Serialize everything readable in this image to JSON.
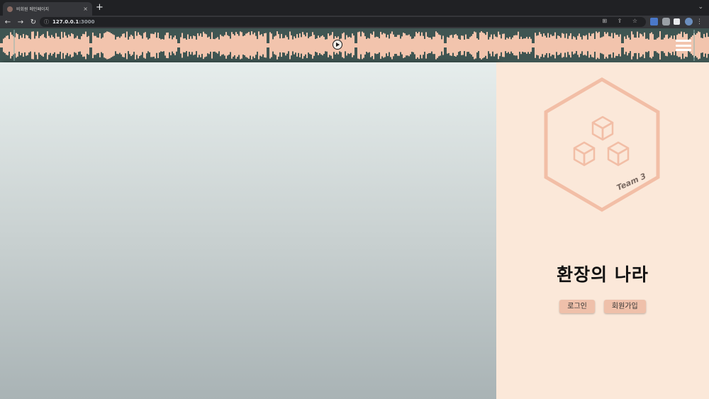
{
  "browser": {
    "tab_title": "비회원 메인페이지",
    "tab_close": "×",
    "new_tab": "+",
    "tab_menu": "⌄",
    "nav": {
      "back": "←",
      "forward": "→",
      "reload": "↻"
    },
    "url_host": "127.0.0.1",
    "url_port": ":3000",
    "info_icon": "ⓘ",
    "tools": "⊞ ⇪ ☆",
    "menu": "⋮"
  },
  "page": {
    "logo_text": "Team 3",
    "site_title": "환장의 나라",
    "login_label": "로그인",
    "signup_label": "회원가입"
  },
  "colors": {
    "wave": "#f2c4ad",
    "band": "#3f5552",
    "panel": "#fbe8d9",
    "button": "#efc0aa"
  }
}
